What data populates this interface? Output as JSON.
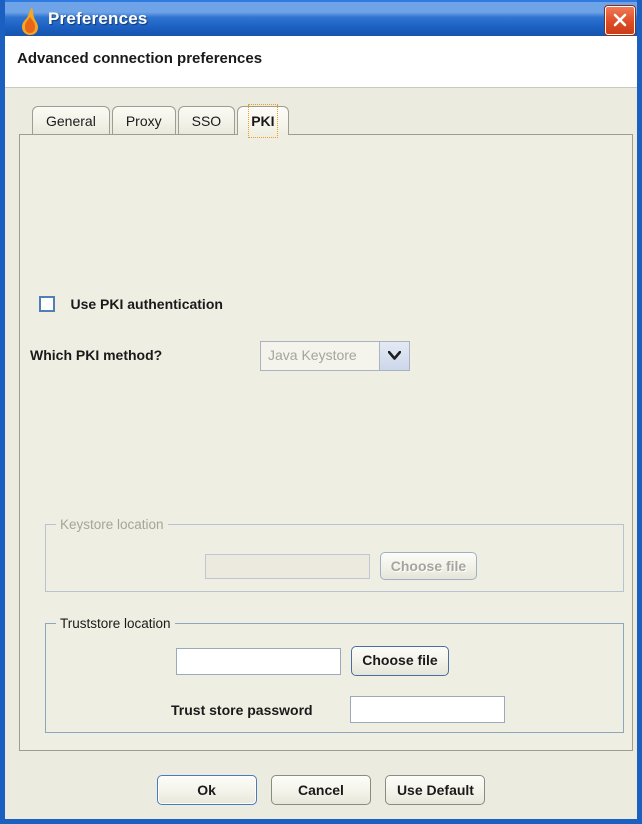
{
  "window": {
    "title": "Preferences",
    "icon": "flame-icon",
    "close_label": "X",
    "accent_blue": "#1b5fc1",
    "background": "#efeee2"
  },
  "header": {
    "title": "Advanced connection preferences"
  },
  "tabs": [
    {
      "label": "General",
      "selected": false
    },
    {
      "label": "Proxy",
      "selected": false
    },
    {
      "label": "SSO",
      "selected": false
    },
    {
      "label": "PKI",
      "selected": true
    }
  ],
  "pki": {
    "use_pki_checkbox": {
      "label": "Use PKI authentication",
      "checked": false
    },
    "method": {
      "label": "Which PKI method?",
      "selected_value": "Java Keystore",
      "options": [
        "Java Keystore"
      ],
      "enabled": false,
      "arrow_icon": "chevron-down-icon"
    },
    "keystore": {
      "group_title": "Keystore location",
      "enabled": false,
      "path_value": "",
      "path_placeholder": "",
      "choose_button": "Choose file"
    },
    "truststore": {
      "group_title": "Truststore location",
      "enabled": true,
      "path_value": "",
      "path_placeholder": "",
      "choose_button": "Choose file",
      "password_label": "Trust store password",
      "password_value": "",
      "password_placeholder": ""
    }
  },
  "footer": {
    "ok_label": "Ok",
    "cancel_label": "Cancel",
    "use_default_label": "Use Default"
  }
}
